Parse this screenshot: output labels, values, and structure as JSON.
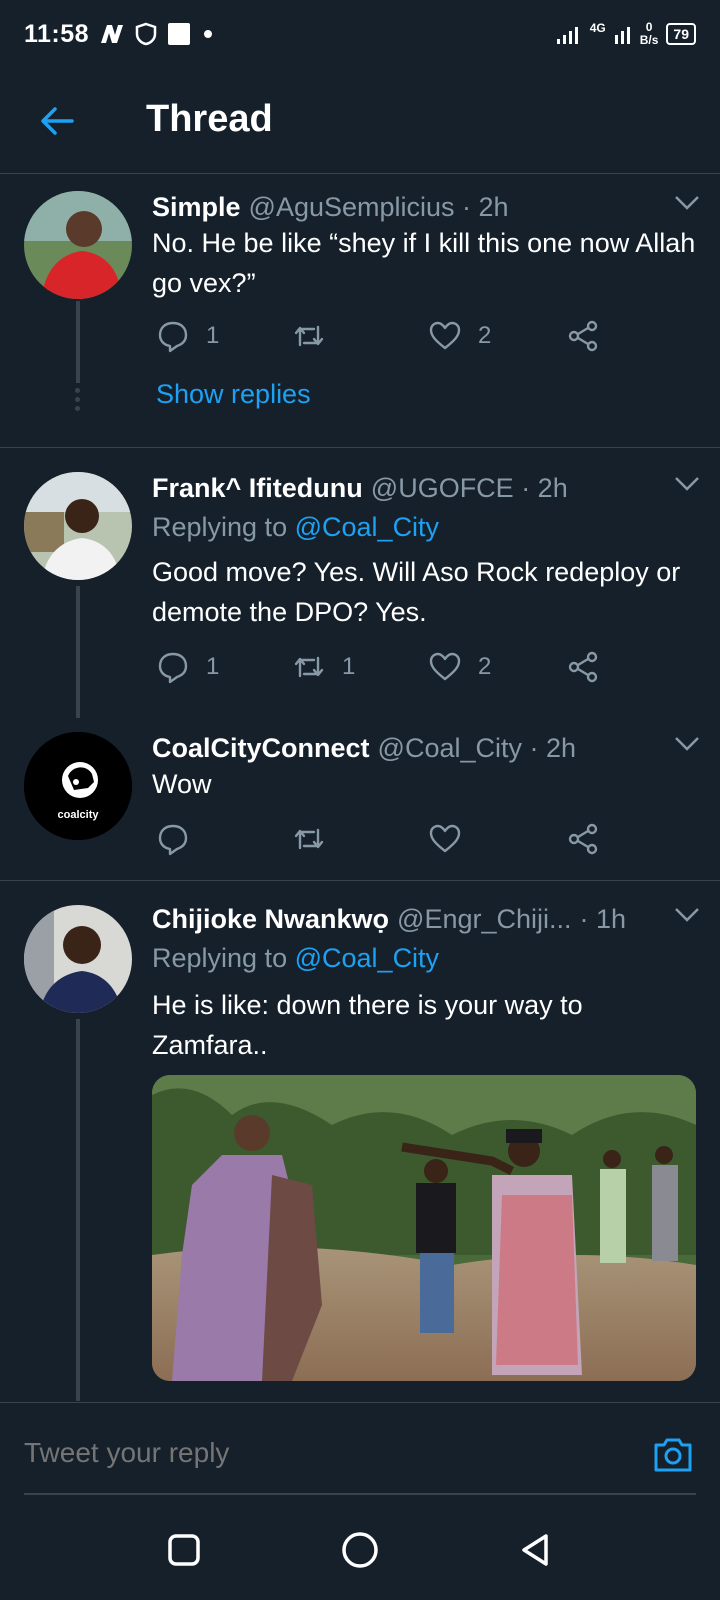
{
  "status": {
    "time": "11:58",
    "carrier_icon": "n-logo-icon",
    "network_label": "4G",
    "speed_value": "0",
    "speed_unit": "B/s",
    "battery": "79"
  },
  "header": {
    "title": "Thread"
  },
  "tweets": [
    {
      "name": "Simple",
      "handle": "@AguSemplicius · 2h",
      "text": "No. He be like “shey if I kill this one now Allah go vex?”",
      "replies": "1",
      "retweets": "",
      "likes": "2",
      "show_replies": "Show replies"
    },
    {
      "name": "Frank^ Ifitedunu",
      "handle": "@UGOFCE · 2h",
      "replying_prefix": "Replying to",
      "replying_to": "@Coal_City",
      "text": "Good move? Yes. Will Aso Rock redeploy or demote the DPO? Yes.",
      "replies": "1",
      "retweets": "1",
      "likes": "2"
    },
    {
      "name": "CoalCityConnect",
      "handle": "@Coal_City · 2h",
      "text": "Wow",
      "avatar_logo": "coalcity",
      "replies": "",
      "retweets": "",
      "likes": ""
    },
    {
      "name": "Chijioke Nwankwọ",
      "handle": "@Engr_Chiji...",
      "time": "· 1h",
      "replying_prefix": "Replying to",
      "replying_to": "@Coal_City",
      "text": "He is like: down there is your way to Zamfara..",
      "media_icon": "photo-icon"
    }
  ],
  "reply": {
    "placeholder": "Tweet your reply"
  },
  "colors": {
    "background": "#15202b",
    "accent": "#1da1f2",
    "secondary_text": "#8899a6",
    "divider": "#38444d"
  }
}
